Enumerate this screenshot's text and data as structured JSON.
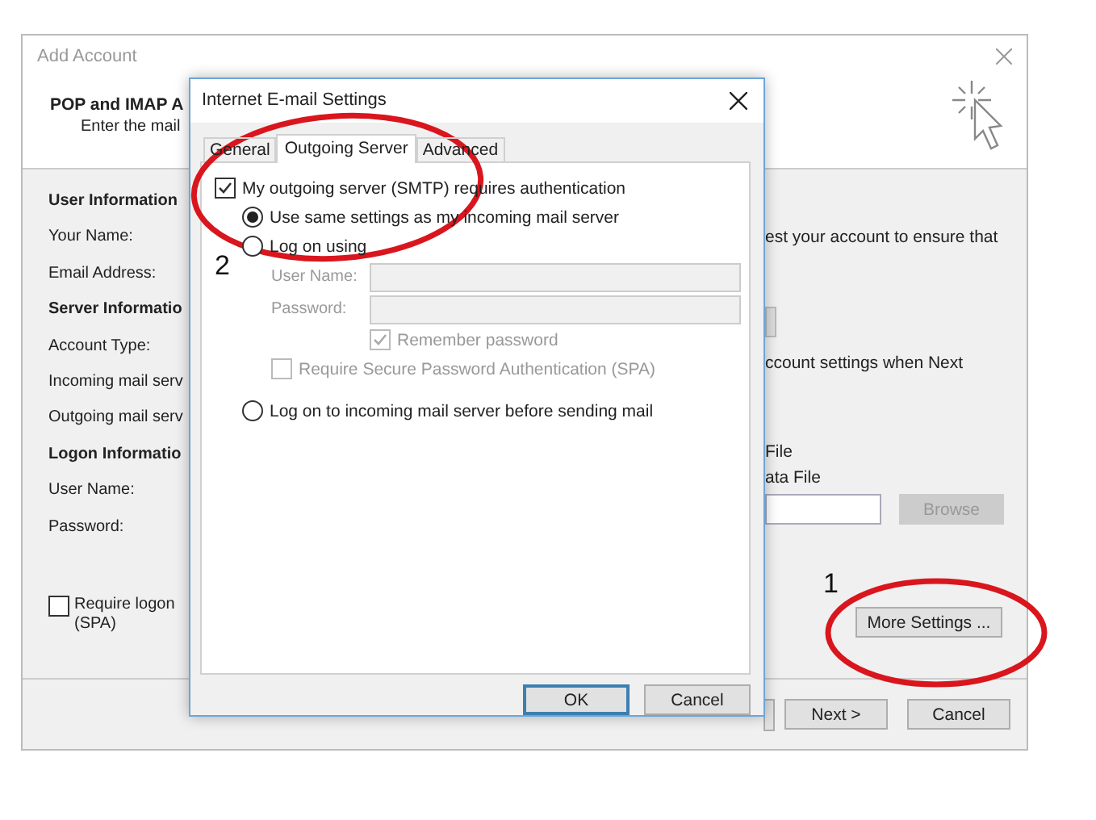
{
  "background_window": {
    "title": "Add Account",
    "heading": "POP and IMAP A",
    "subheading": "Enter the mail",
    "left_labels": [
      {
        "kind": "heading",
        "text": "User Information"
      },
      {
        "kind": "label",
        "text": "Your Name:"
      },
      {
        "kind": "label",
        "text": "Email Address:"
      },
      {
        "kind": "heading",
        "text": "Server Informatio"
      },
      {
        "kind": "label",
        "text": "Account Type:"
      },
      {
        "kind": "label",
        "text": "Incoming mail serv"
      },
      {
        "kind": "label",
        "text": "Outgoing mail serv"
      },
      {
        "kind": "heading",
        "text": "Logon Informatio"
      },
      {
        "kind": "label",
        "text": "User Name:"
      },
      {
        "kind": "label",
        "text": "Password:"
      }
    ],
    "spa_checkbox": {
      "label": "Require logon",
      "label_line2": "(SPA)",
      "checked": false
    },
    "right_texts": [
      "est your account to ensure that",
      "ccount settings when Next",
      "File",
      "ata File"
    ],
    "browse_button": {
      "label": "Browse",
      "disabled": true
    },
    "more_settings_button": "More Settings ...",
    "buttons": [
      "Next >",
      "Cancel"
    ]
  },
  "dialog": {
    "title": "Internet E-mail Settings",
    "tabs": [
      {
        "label": "General",
        "selected": false
      },
      {
        "label": "Outgoing Server",
        "selected": true
      },
      {
        "label": "Advanced",
        "selected": false
      }
    ],
    "smtp_auth": {
      "label": "My outgoing server (SMTP) requires authentication",
      "checked": true
    },
    "options": [
      {
        "kind": "radio",
        "label": "Use same settings as my incoming mail server",
        "selected": true
      },
      {
        "kind": "radio",
        "label": "Log on using",
        "selected": false
      },
      {
        "kind": "field",
        "label": "User Name:",
        "disabled": true
      },
      {
        "kind": "field",
        "label": "Password:",
        "disabled": true
      },
      {
        "kind": "checkbox",
        "label": "Remember password",
        "checked": true,
        "disabled": true
      },
      {
        "kind": "checkbox",
        "label": "Require Secure Password Authentication (SPA)",
        "checked": false,
        "disabled": true
      },
      {
        "kind": "radio",
        "label": "Log on to incoming mail server before sending mail",
        "selected": false
      }
    ],
    "buttons": [
      "OK",
      "Cancel"
    ]
  },
  "annotations": [
    {
      "label": "2"
    },
    {
      "label": "1"
    }
  ]
}
